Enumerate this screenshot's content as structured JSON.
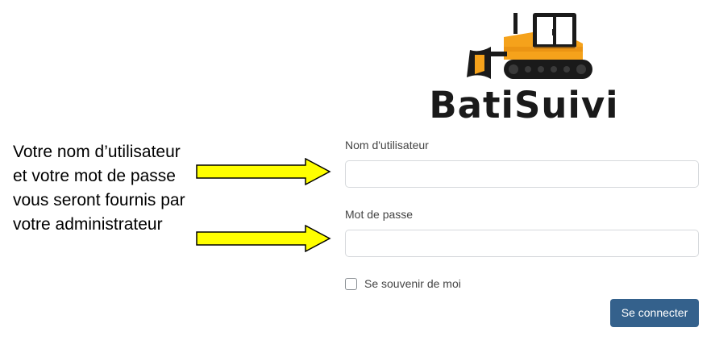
{
  "logo": {
    "text": "BatiSuivi",
    "icon": "bulldozer-icon",
    "colors": {
      "body": "#f5a21b",
      "dark": "#1a1a1a"
    }
  },
  "annotation": {
    "text": "Votre nom d’utilisateur et votre mot de passe vous seront fournis par votre administrateur",
    "arrow_color": "#ffff00"
  },
  "form": {
    "username_label": "Nom d'utilisateur",
    "username_value": "",
    "password_label": "Mot de passe",
    "password_value": "",
    "remember_label": "Se souvenir de moi",
    "remember_checked": false,
    "submit_label": "Se connecter"
  },
  "colors": {
    "button": "#34618c",
    "input_border": "#d6d9dc"
  }
}
